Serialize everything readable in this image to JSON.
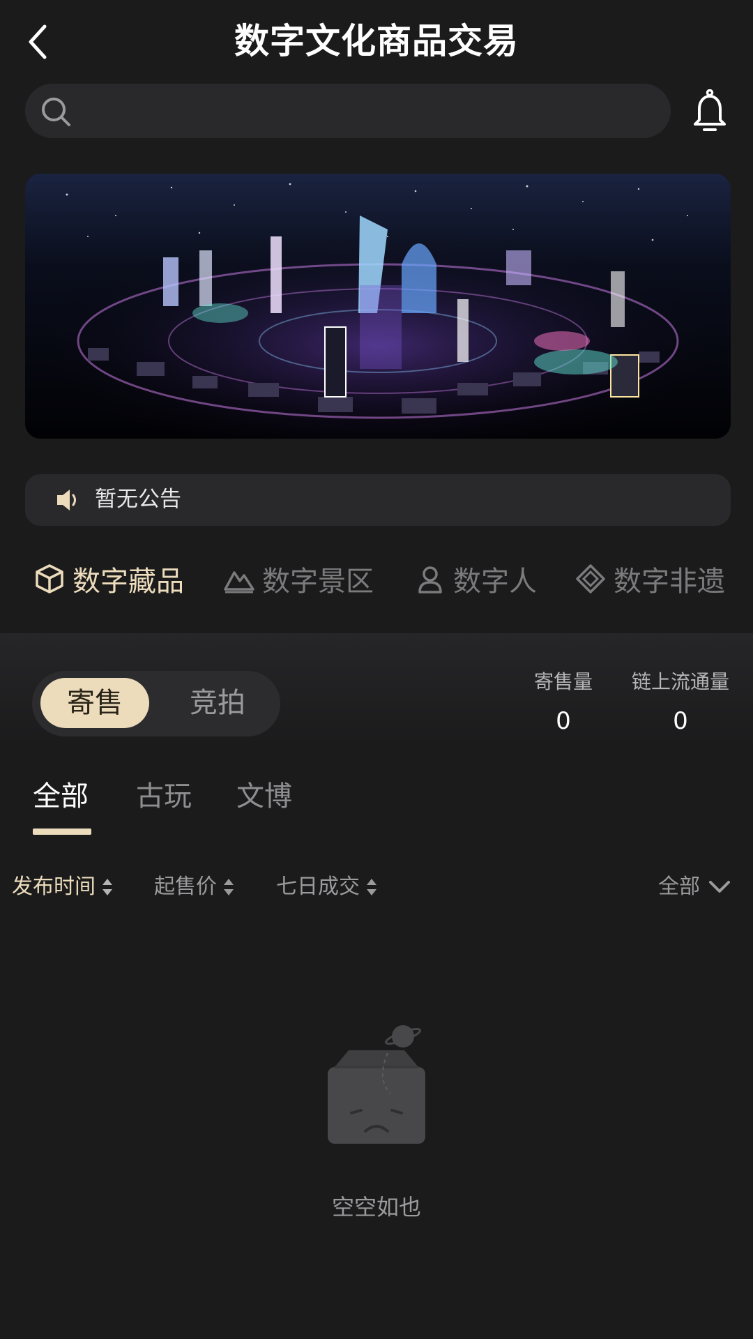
{
  "header": {
    "title": "数字文化商品交易",
    "back_icon": "chevron-left-icon"
  },
  "search": {
    "placeholder": "",
    "icon": "search-icon"
  },
  "notification": {
    "icon": "bell-icon"
  },
  "notice": {
    "text": "暂无公告",
    "icon": "speaker-icon"
  },
  "categories": [
    {
      "label": "数字藏品",
      "icon": "cube-icon",
      "active": true
    },
    {
      "label": "数字景区",
      "icon": "mountain-icon",
      "active": false
    },
    {
      "label": "数字人",
      "icon": "person-icon",
      "active": false
    },
    {
      "label": "数字非遗",
      "icon": "diamond-icon",
      "active": false
    }
  ],
  "mode_toggle": {
    "options": [
      "寄售",
      "竞拍"
    ],
    "selected": "寄售"
  },
  "stats": [
    {
      "label": "寄售量",
      "value": "0"
    },
    {
      "label": "链上流通量",
      "value": "0"
    }
  ],
  "tabs": [
    {
      "label": "全部",
      "active": true
    },
    {
      "label": "古玩",
      "active": false
    },
    {
      "label": "文博",
      "active": false
    }
  ],
  "sort_options": [
    {
      "label": "发布时间",
      "active": true
    },
    {
      "label": "起售价",
      "active": false
    },
    {
      "label": "七日成交",
      "active": false
    }
  ],
  "filter": {
    "label": "全部",
    "icon": "chevron-down-icon"
  },
  "empty_state": {
    "text": "空空如也",
    "icon": "empty-box-icon"
  },
  "colors": {
    "accent": "#ecdcbc",
    "background": "#1b1b1c",
    "surface": "#29292b"
  }
}
